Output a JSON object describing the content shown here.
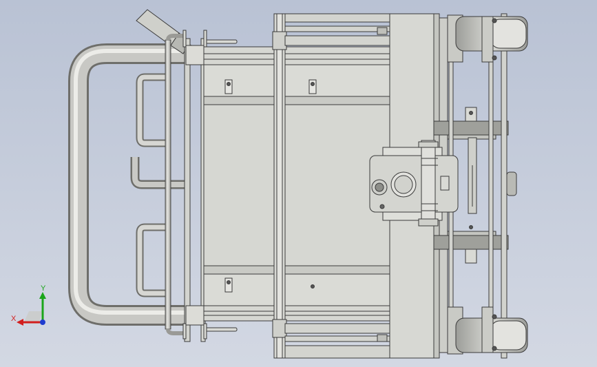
{
  "viewport": {
    "background_top": "#b9c2d4",
    "background_bottom": "#d3d8e3",
    "edge_color": "#3a3a3a"
  },
  "model": {
    "part_fill": "#d6d7d2",
    "part_fill_dark": "#b8b9b4",
    "handle_highlight": "#e6e6e2",
    "handle_shadow": "#8a8a86"
  },
  "triad": {
    "x_label": "X",
    "y_label": "Y",
    "x_color": "#d21e1e",
    "y_color": "#1aa51a",
    "z_color": "#1e3ccf"
  }
}
